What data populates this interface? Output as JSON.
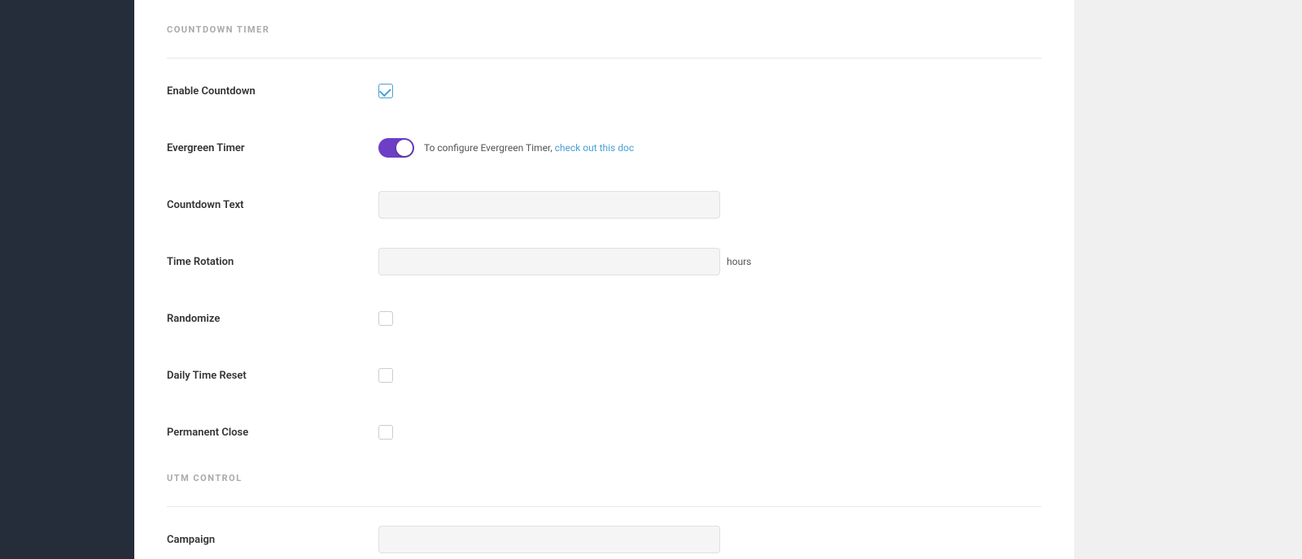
{
  "sidebar": {
    "background": "#252d3a"
  },
  "countdown_section": {
    "title": "COUNTDOWN TIMER",
    "fields": [
      {
        "id": "enable-countdown",
        "label": "Enable Countdown",
        "type": "checkbox",
        "checked": true
      },
      {
        "id": "evergreen-timer",
        "label": "Evergreen Timer",
        "type": "toggle",
        "enabled": true,
        "helper_text": "To configure Evergreen Timer, ",
        "link_text": "check out this doc",
        "link_href": "#"
      },
      {
        "id": "countdown-text",
        "label": "Countdown Text",
        "type": "text",
        "placeholder": "",
        "value": ""
      },
      {
        "id": "time-rotation",
        "label": "Time Rotation",
        "type": "text-suffix",
        "suffix": "hours",
        "placeholder": "",
        "value": ""
      },
      {
        "id": "randomize",
        "label": "Randomize",
        "type": "checkbox",
        "checked": false
      },
      {
        "id": "daily-time-reset",
        "label": "Daily Time Reset",
        "type": "checkbox",
        "checked": false
      },
      {
        "id": "permanent-close",
        "label": "Permanent Close",
        "type": "checkbox",
        "checked": false
      }
    ]
  },
  "utm_section": {
    "title": "UTM CONTROL",
    "fields": [
      {
        "id": "campaign",
        "label": "Campaign",
        "type": "text",
        "placeholder": "",
        "value": ""
      }
    ]
  }
}
